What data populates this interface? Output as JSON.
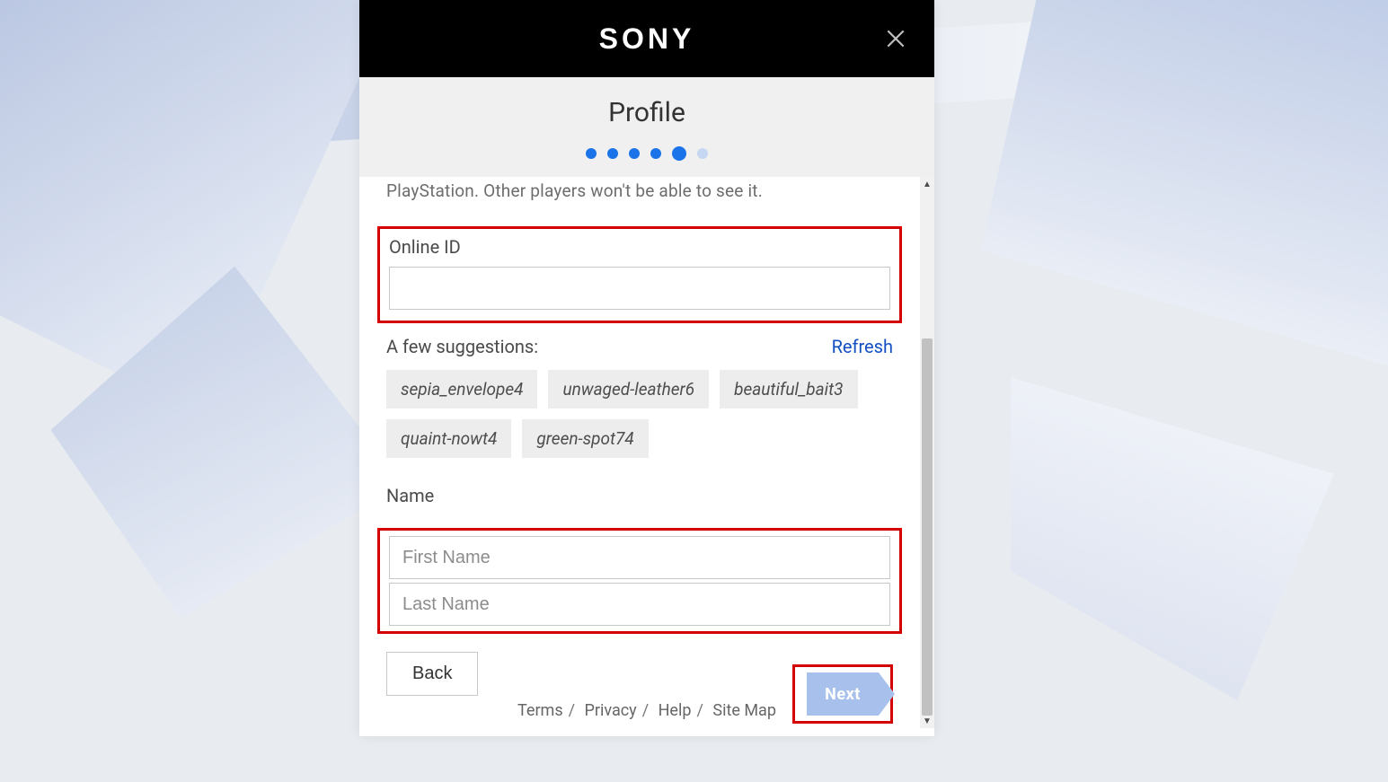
{
  "brand": "SONY",
  "page_title": "Profile",
  "progress": {
    "total": 6,
    "current_index": 4
  },
  "truncated_line": "PlayStation. Other players won't be able to see it.",
  "online_id": {
    "label": "Online ID",
    "value": ""
  },
  "suggestions": {
    "label": "A few suggestions:",
    "refresh": "Refresh",
    "items": [
      "sepia_envelope4",
      "unwaged-leather6",
      "beautiful_bait3",
      "quaint-nowt4",
      "green-spot74"
    ]
  },
  "name": {
    "label": "Name",
    "first_placeholder": "First Name",
    "last_placeholder": "Last Name",
    "first_value": "",
    "last_value": ""
  },
  "buttons": {
    "back": "Back",
    "next": "Next"
  },
  "footer": {
    "terms": "Terms",
    "privacy": "Privacy",
    "help": "Help",
    "sitemap": "Site Map"
  },
  "highlight_color": "#d40000",
  "accent_color": "#1a73e8"
}
